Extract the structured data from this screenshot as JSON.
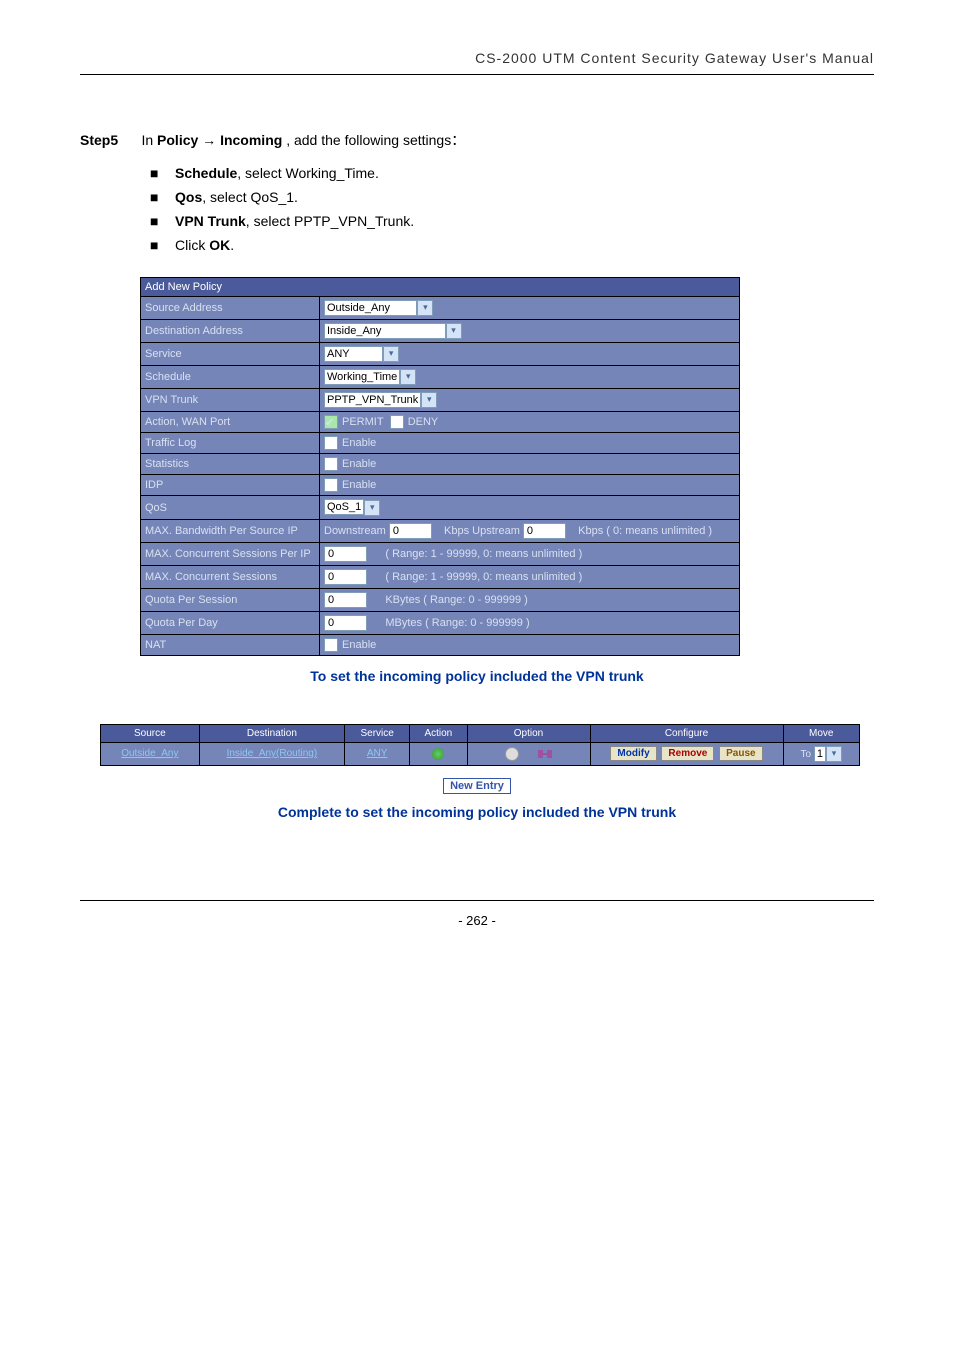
{
  "header": "CS-2000 UTM Content Security Gateway User's Manual",
  "step": {
    "label": "Step5",
    "text_prefix": "In ",
    "b1": "Policy",
    "arrow": " → ",
    "b2": "Incoming",
    "text_suffix": " , add the following settings："
  },
  "bullets": [
    {
      "b": "Schedule",
      "t": ", select Working_Time."
    },
    {
      "b": "Qos",
      "t": ", select QoS_1."
    },
    {
      "b": "VPN Trunk",
      "t": ", select PPTP_VPN_Trunk."
    },
    {
      "b": "",
      "t": "Click ",
      "b2": "OK",
      "t2": "."
    }
  ],
  "form": {
    "title": "Add New Policy",
    "rows": {
      "src": {
        "label": "Source Address",
        "value": "Outside_Any"
      },
      "dst": {
        "label": "Destination Address",
        "value": "Inside_Any"
      },
      "svc": {
        "label": "Service",
        "value": "ANY"
      },
      "sch": {
        "label": "Schedule",
        "value": "Working_Time"
      },
      "vpn": {
        "label": "VPN Trunk",
        "value": "PPTP_VPN_Trunk"
      },
      "act": {
        "label": "Action, WAN Port",
        "permit": "PERMIT",
        "deny": "DENY"
      },
      "log": {
        "label": "Traffic Log",
        "enable": "Enable"
      },
      "stat": {
        "label": "Statistics",
        "enable": "Enable"
      },
      "idp": {
        "label": "IDP",
        "enable": "Enable"
      },
      "qos": {
        "label": "QoS",
        "value": "QoS_1"
      },
      "bw": {
        "label": "MAX. Bandwidth Per Source IP",
        "down": "Downstream",
        "dval": "0",
        "kup": "Kbps Upstream",
        "uval": "0",
        "hint": "Kbps ( 0: means unlimited )"
      },
      "csip": {
        "label": "MAX. Concurrent Sessions Per IP",
        "val": "0",
        "hint": "( Range: 1 - 99999, 0: means unlimited )"
      },
      "cs": {
        "label": "MAX. Concurrent Sessions",
        "val": "0",
        "hint": "( Range: 1 - 99999, 0: means unlimited )"
      },
      "qps": {
        "label": "Quota Per Session",
        "val": "0",
        "hint": "KBytes  ( Range: 0 - 999999 )"
      },
      "qpd": {
        "label": "Quota Per Day",
        "val": "0",
        "hint": "MBytes  ( Range: 0 - 999999 )"
      },
      "nat": {
        "label": "NAT",
        "enable": "Enable"
      }
    }
  },
  "caption1": "To set the incoming policy included the VPN trunk",
  "grid": {
    "headers": [
      "Source",
      "Destination",
      "Service",
      "Action",
      "Option",
      "Configure",
      "Move"
    ],
    "row": {
      "source": "Outside_Any",
      "dest": "Inside_Any(Routing)",
      "service": "ANY",
      "modify": "Modify",
      "remove": "Remove",
      "pause": "Pause",
      "to": "To",
      "toval": "1"
    }
  },
  "newEntry": "New Entry",
  "caption2": "Complete to set the incoming policy included the VPN trunk",
  "pageNum": "- 262 -"
}
